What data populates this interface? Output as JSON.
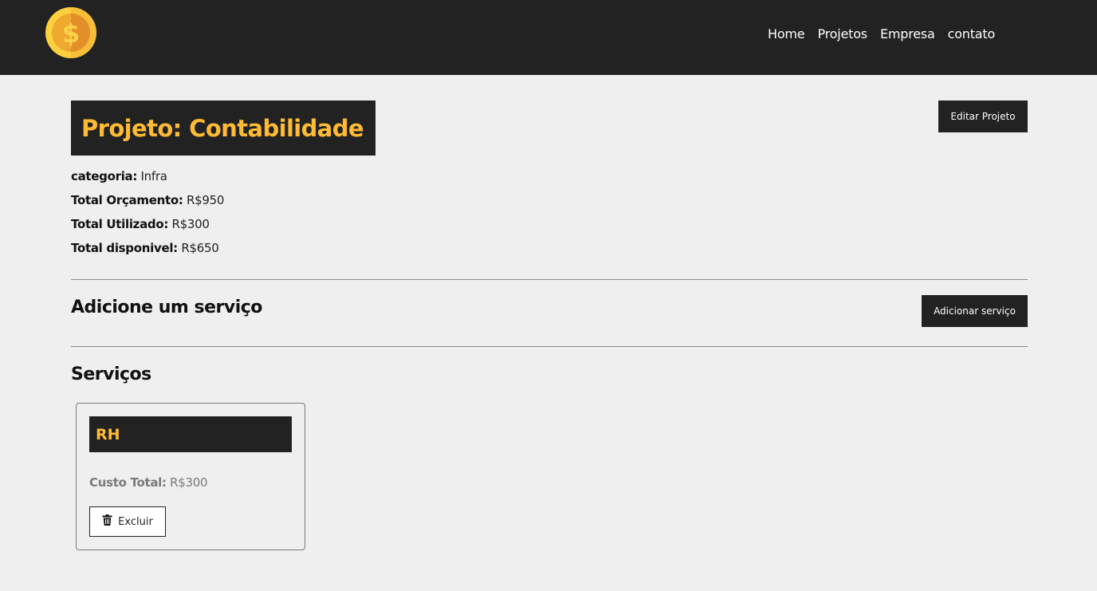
{
  "nav": {
    "logo_icon": "dollar-coin-icon",
    "links": [
      "Home",
      "Projetos",
      "Empresa",
      "contato"
    ]
  },
  "project": {
    "title": "Projeto: Contabilidade",
    "edit_label": "Editar Projeto",
    "category_label": "categoria:",
    "category_value": "Infra",
    "budget_label": "Total Orçamento:",
    "budget_value": "R$950",
    "used_label": "Total Utilizado:",
    "used_value": "R$300",
    "available_label": "Total disponivel:",
    "available_value": "R$650"
  },
  "add_service": {
    "title": "Adicione um serviço",
    "button_label": "Adicionar serviço"
  },
  "services": {
    "title": "Serviços",
    "items": [
      {
        "name": "RH",
        "cost_label": "Custo Total:",
        "cost_value": "R$300",
        "delete_label": "Excluir",
        "delete_icon": "trash-icon"
      }
    ]
  },
  "colors": {
    "dark": "#222222",
    "accent": "#ffbb33",
    "background": "#efefef"
  }
}
